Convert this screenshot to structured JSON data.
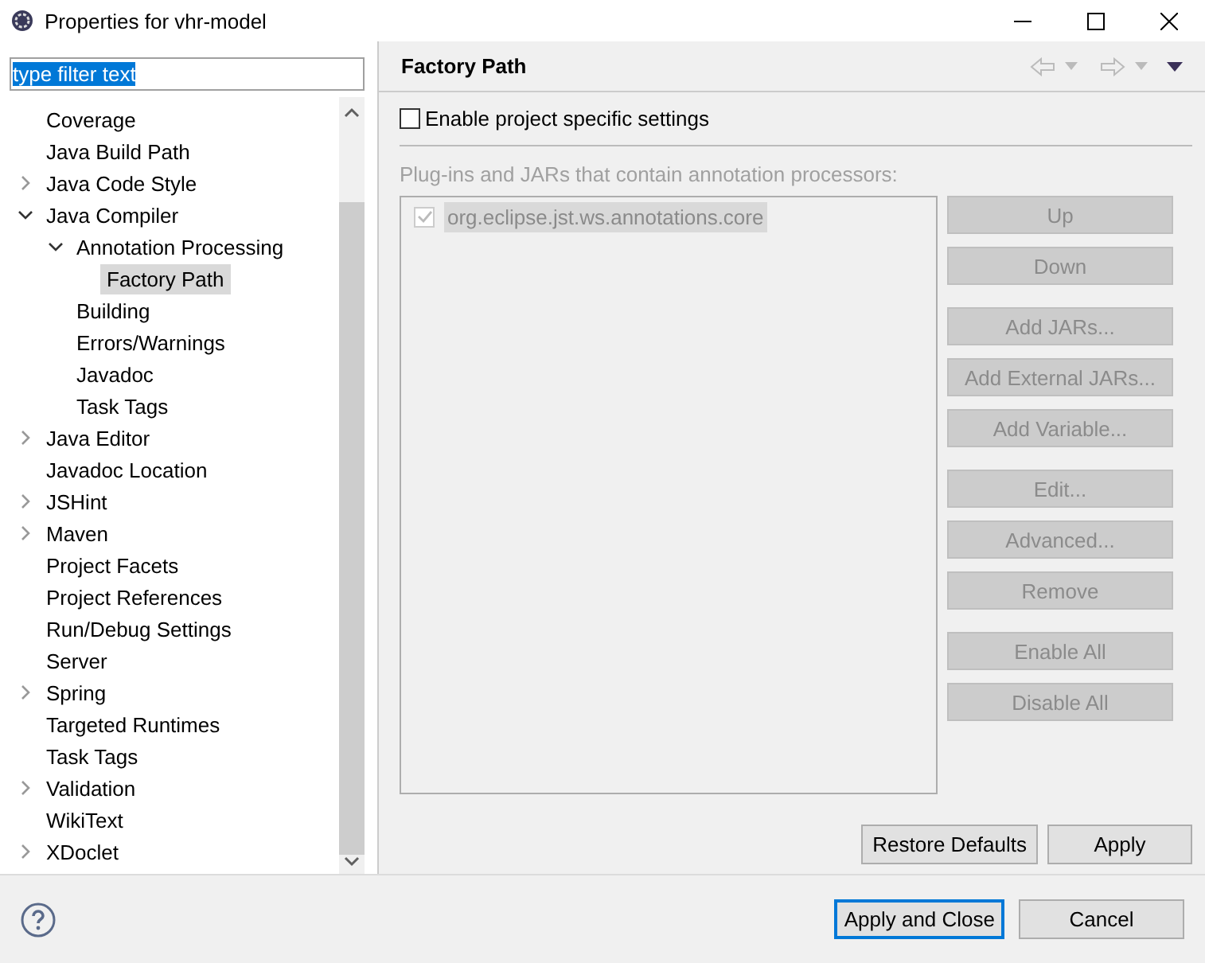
{
  "window": {
    "title": "Properties for vhr-model"
  },
  "filter": {
    "value": "type filter text"
  },
  "tree": [
    {
      "label": "Coverage",
      "selected": false
    },
    {
      "label": "Java Build Path",
      "selected": false
    },
    {
      "label": "Java Code Style",
      "selected": false,
      "expanded": false
    },
    {
      "label": "Java Compiler",
      "selected": false,
      "expanded": true,
      "children": [
        {
          "label": "Annotation Processing",
          "selected": false,
          "expanded": true,
          "children": [
            {
              "label": "Factory Path",
              "selected": true
            }
          ]
        },
        {
          "label": "Building",
          "selected": false
        },
        {
          "label": "Errors/Warnings",
          "selected": false
        },
        {
          "label": "Javadoc",
          "selected": false
        },
        {
          "label": "Task Tags",
          "selected": false
        }
      ]
    },
    {
      "label": "Java Editor",
      "selected": false,
      "expanded": false
    },
    {
      "label": "Javadoc Location",
      "selected": false
    },
    {
      "label": "JSHint",
      "selected": false,
      "expanded": false
    },
    {
      "label": "Maven",
      "selected": false,
      "expanded": false
    },
    {
      "label": "Project Facets",
      "selected": false
    },
    {
      "label": "Project References",
      "selected": false
    },
    {
      "label": "Run/Debug Settings",
      "selected": false
    },
    {
      "label": "Server",
      "selected": false
    },
    {
      "label": "Spring",
      "selected": false,
      "expanded": false
    },
    {
      "label": "Targeted Runtimes",
      "selected": false
    },
    {
      "label": "Task Tags",
      "selected": false
    },
    {
      "label": "Validation",
      "selected": false,
      "expanded": false
    },
    {
      "label": "WikiText",
      "selected": false
    },
    {
      "label": "XDoclet",
      "selected": false,
      "expanded": false
    }
  ],
  "page": {
    "title": "Factory Path",
    "enable": {
      "label": "Enable project specific settings",
      "checked": false
    },
    "list_label": "Plug-ins and JARs that contain annotation processors:",
    "jars": [
      {
        "label": "org.eclipse.jst.ws.annotations.core",
        "checked": true,
        "selected": true
      }
    ],
    "side_button_groups": [
      [
        {
          "label": "Up",
          "disabled": true
        },
        {
          "label": "Down",
          "disabled": true
        }
      ],
      [
        {
          "label": "Add JARs...",
          "disabled": true
        },
        {
          "label": "Add External JARs...",
          "disabled": true
        },
        {
          "label": "Add Variable...",
          "disabled": true
        }
      ],
      [
        {
          "label": "Edit...",
          "disabled": true
        },
        {
          "label": "Advanced...",
          "disabled": true
        },
        {
          "label": "Remove",
          "disabled": true
        }
      ],
      [
        {
          "label": "Enable All",
          "disabled": true
        },
        {
          "label": "Disable All",
          "disabled": true
        }
      ]
    ],
    "bottom_buttons": [
      {
        "label": "Restore Defaults",
        "disabled": false
      },
      {
        "label": "Apply",
        "disabled": false
      }
    ]
  },
  "footer": {
    "buttons": [
      {
        "label": "Apply and Close",
        "default": true
      },
      {
        "label": "Cancel",
        "default": false
      }
    ]
  }
}
